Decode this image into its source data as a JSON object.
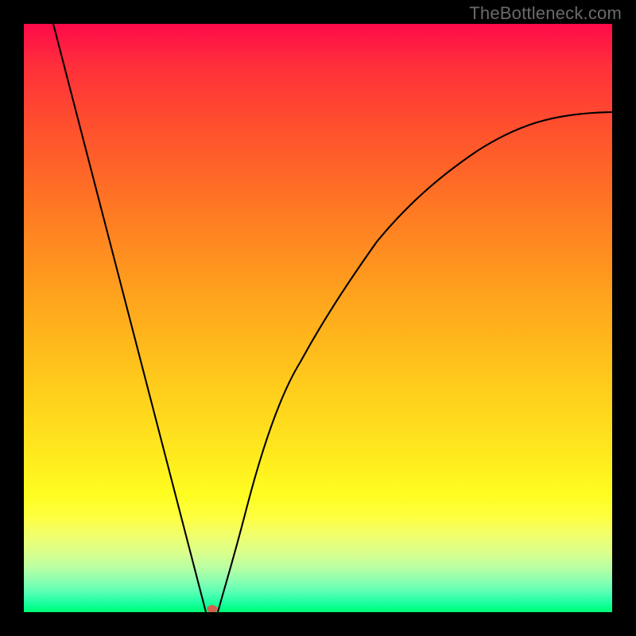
{
  "watermark_text": "TheBottleneck.com",
  "chart_data": {
    "type": "line",
    "title": "",
    "xlabel": "",
    "ylabel": "",
    "xlim": [
      0,
      100
    ],
    "ylim": [
      0,
      100
    ],
    "grid": false,
    "legend": false,
    "background_gradient": {
      "direction": "vertical",
      "stops": [
        {
          "pos": 0.0,
          "color": "#ff0a4a"
        },
        {
          "pos": 0.5,
          "color": "#ffa21d"
        },
        {
          "pos": 0.82,
          "color": "#fffd20"
        },
        {
          "pos": 1.0,
          "color": "#00ff6e"
        }
      ]
    },
    "series": [
      {
        "name": "left-segment",
        "x": [
          5.0,
          10.0,
          15.0,
          20.0,
          25.0,
          30.0,
          31.0
        ],
        "y": [
          100.0,
          81.0,
          61.5,
          42.5,
          23.5,
          4.0,
          0.0
        ]
      },
      {
        "name": "right-segment",
        "x": [
          33.0,
          35.0,
          38.0,
          42.0,
          47.0,
          53.0,
          60.0,
          68.0,
          77.0,
          87.0,
          100.0
        ],
        "y": [
          0.0,
          7.5,
          18.0,
          30.5,
          42.5,
          53.5,
          63.0,
          70.5,
          76.5,
          81.0,
          85.0
        ]
      }
    ],
    "markers": [
      {
        "name": "minimum-marker",
        "x": 32.0,
        "y": 0.0,
        "color": "#d2614e",
        "rx": 6,
        "ry": 5
      }
    ]
  }
}
